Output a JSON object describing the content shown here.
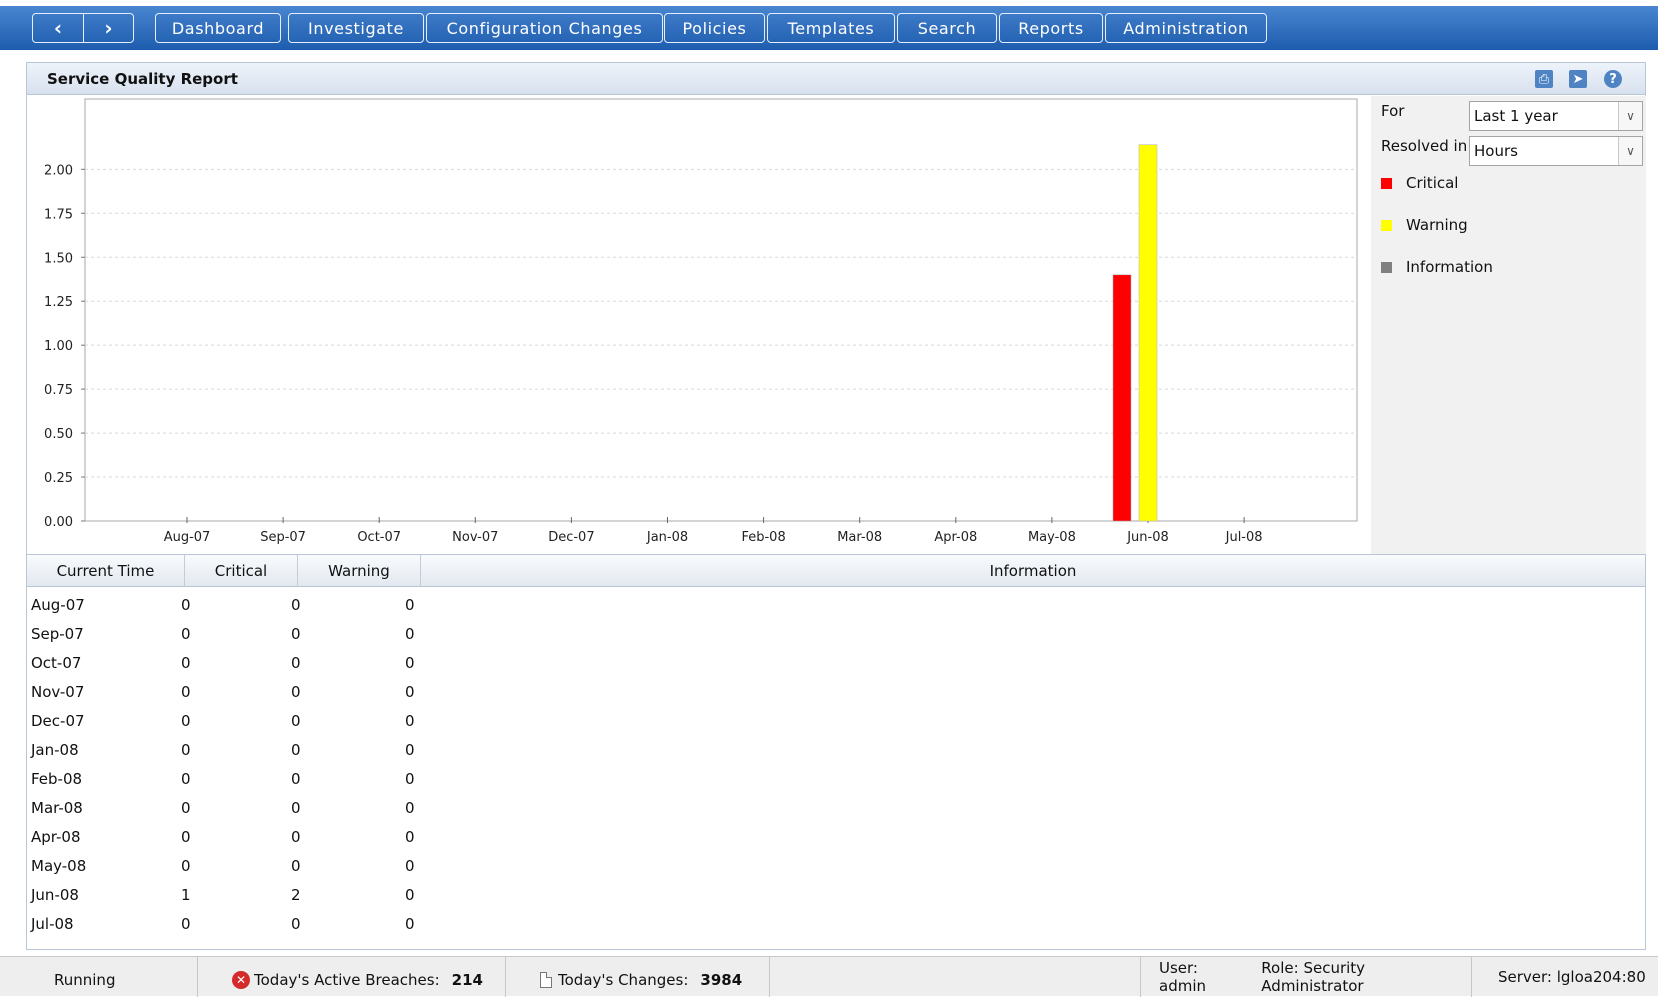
{
  "nav": {
    "back_icon": "chevron-left-icon",
    "forward_icon": "chevron-right-icon",
    "tabs": [
      "Dashboard",
      "Investigate",
      "Configuration Changes",
      "Policies",
      "Templates",
      "Search",
      "Reports",
      "Administration"
    ]
  },
  "panel": {
    "title": "Service Quality Report",
    "icons": [
      "print-icon",
      "export-icon",
      "help-icon"
    ]
  },
  "controls": {
    "for_label": "For",
    "for_value": "Last 1 year",
    "resolved_label": "Resolved in",
    "resolved_value": "Hours"
  },
  "chart_data": {
    "type": "bar",
    "categories": [
      "Aug-07",
      "Sep-07",
      "Oct-07",
      "Nov-07",
      "Dec-07",
      "Jan-08",
      "Feb-08",
      "Mar-08",
      "Apr-08",
      "May-08",
      "Jun-08",
      "Jul-08"
    ],
    "series": [
      {
        "name": "Critical",
        "color": "#ff0000",
        "values": [
          0,
          0,
          0,
          0,
          0,
          0,
          0,
          0,
          0,
          0,
          1.4,
          0
        ]
      },
      {
        "name": "Warning",
        "color": "#ffff00",
        "values": [
          0,
          0,
          0,
          0,
          0,
          0,
          0,
          0,
          0,
          0,
          2.14,
          0
        ]
      },
      {
        "name": "Information",
        "color": "#808080",
        "values": [
          0,
          0,
          0,
          0,
          0,
          0,
          0,
          0,
          0,
          0,
          0,
          0
        ]
      }
    ],
    "yticks": [
      "0.00",
      "0.25",
      "0.50",
      "0.75",
      "1.00",
      "1.25",
      "1.50",
      "1.75",
      "2.00"
    ],
    "ylim": [
      0,
      2.4
    ],
    "grid": true,
    "legend": "right"
  },
  "table": {
    "headers": [
      "Current Time",
      "Critical",
      "Warning",
      "Information"
    ],
    "rows": [
      [
        "Aug-07",
        "0",
        "0",
        "0"
      ],
      [
        "Sep-07",
        "0",
        "0",
        "0"
      ],
      [
        "Oct-07",
        "0",
        "0",
        "0"
      ],
      [
        "Nov-07",
        "0",
        "0",
        "0"
      ],
      [
        "Dec-07",
        "0",
        "0",
        "0"
      ],
      [
        "Jan-08",
        "0",
        "0",
        "0"
      ],
      [
        "Feb-08",
        "0",
        "0",
        "0"
      ],
      [
        "Mar-08",
        "0",
        "0",
        "0"
      ],
      [
        "Apr-08",
        "0",
        "0",
        "0"
      ],
      [
        "May-08",
        "0",
        "0",
        "0"
      ],
      [
        "Jun-08",
        "1",
        "2",
        "0"
      ],
      [
        "Jul-08",
        "0",
        "0",
        "0"
      ]
    ]
  },
  "status": {
    "state": "Running",
    "breaches_label": "Today's Active Breaches:",
    "breaches_value": "214",
    "changes_label": "Today's Changes:",
    "changes_value": "3984",
    "user_text": "User: admin",
    "role_text": "Role: Security Administrator",
    "server_text": "Server: lgloa204:80"
  },
  "colors": {
    "nav_blue": "#2563b4",
    "critical": "#ff0000",
    "warning": "#ffff00",
    "information": "#808080"
  }
}
